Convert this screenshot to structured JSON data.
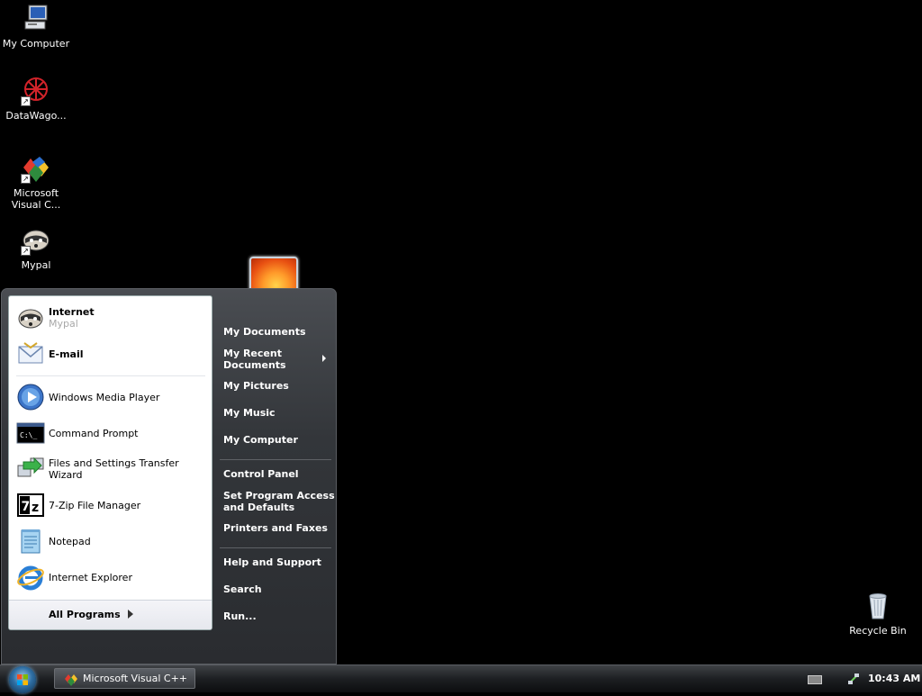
{
  "desktop": {
    "icons": [
      {
        "label": "My Computer"
      },
      {
        "label": "DataWago..."
      },
      {
        "label_line1": "Microsoft",
        "label_line2": "Visual C..."
      },
      {
        "label": "Mypal"
      },
      {
        "label": "Recycle Bin"
      }
    ]
  },
  "start_menu": {
    "pinned": [
      {
        "title": "Internet",
        "subtitle": "Mypal"
      },
      {
        "title": "E-mail"
      }
    ],
    "recent": [
      {
        "label": "Windows Media Player"
      },
      {
        "label": "Command Prompt"
      },
      {
        "label": "Files and Settings Transfer Wizard"
      },
      {
        "label": "7-Zip File Manager"
      },
      {
        "label": "Notepad"
      },
      {
        "label": "Internet Explorer"
      }
    ],
    "all_programs": "All Programs",
    "right": {
      "my_documents": "My Documents",
      "my_recent_1": "My Recent",
      "my_recent_2": "Documents",
      "my_pictures": "My Pictures",
      "my_music": "My Music",
      "my_computer": "My Computer",
      "control_panel": "Control Panel",
      "set_program_1": "Set Program Access",
      "set_program_2": "and Defaults",
      "printers": "Printers and Faxes",
      "help": "Help and Support",
      "search": "Search",
      "run": "Run..."
    }
  },
  "taskbar": {
    "task_label": "Microsoft Visual C++",
    "clock": "10:43 AM"
  }
}
